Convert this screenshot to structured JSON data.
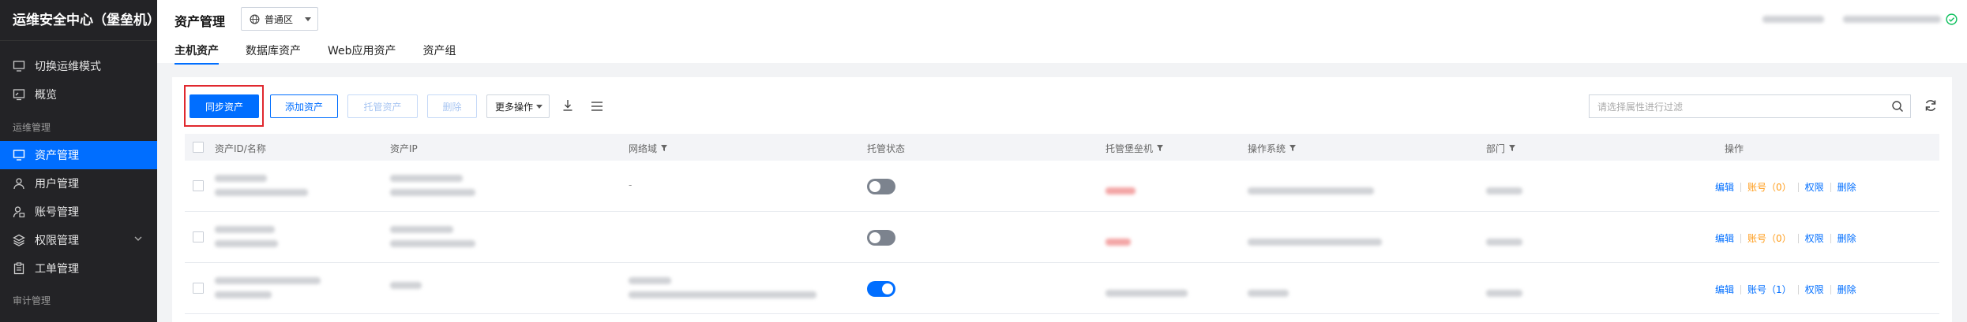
{
  "sidebar": {
    "title": "运维安全中心（堡垒机）",
    "switch_mode": "切换运维模式",
    "overview": "概览",
    "group_ops": "运维管理",
    "items": [
      {
        "label": "资产管理",
        "active": true
      },
      {
        "label": "用户管理"
      },
      {
        "label": "账号管理"
      },
      {
        "label": "权限管理"
      },
      {
        "label": "工单管理"
      }
    ],
    "group_audit": "审计管理"
  },
  "header": {
    "title": "资产管理",
    "region": "普通区",
    "tabs": [
      "主机资产",
      "数据库资产",
      "Web应用资产",
      "资产组"
    ]
  },
  "toolbar": {
    "sync": "同步资产",
    "add": "添加资产",
    "host": "托管资产",
    "delete": "删除",
    "more": "更多操作",
    "search_placeholder": "请选择属性进行过滤"
  },
  "table": {
    "columns": [
      "资产ID/名称",
      "资产IP",
      "网络域",
      "托管状态",
      "托管堡垒机",
      "操作系统",
      "部门",
      "操作"
    ],
    "rows": [
      {
        "network_domain": "-",
        "hosted": false,
        "ops": {
          "edit": "编辑",
          "account": "账号（0）",
          "permission": "权限",
          "delete": "删除"
        }
      },
      {
        "network_domain": "",
        "hosted": false,
        "ops": {
          "edit": "编辑",
          "account": "账号（0）",
          "permission": "权限",
          "delete": "删除"
        }
      },
      {
        "network_domain": "",
        "hosted": true,
        "ops": {
          "edit": "编辑",
          "account": "账号（1）",
          "permission": "权限",
          "delete": "删除"
        }
      }
    ]
  },
  "colors": {
    "accent": "#006eff",
    "warning": "#ff9c19",
    "sidebar_bg": "#232326",
    "highlight": "#e0282e"
  }
}
